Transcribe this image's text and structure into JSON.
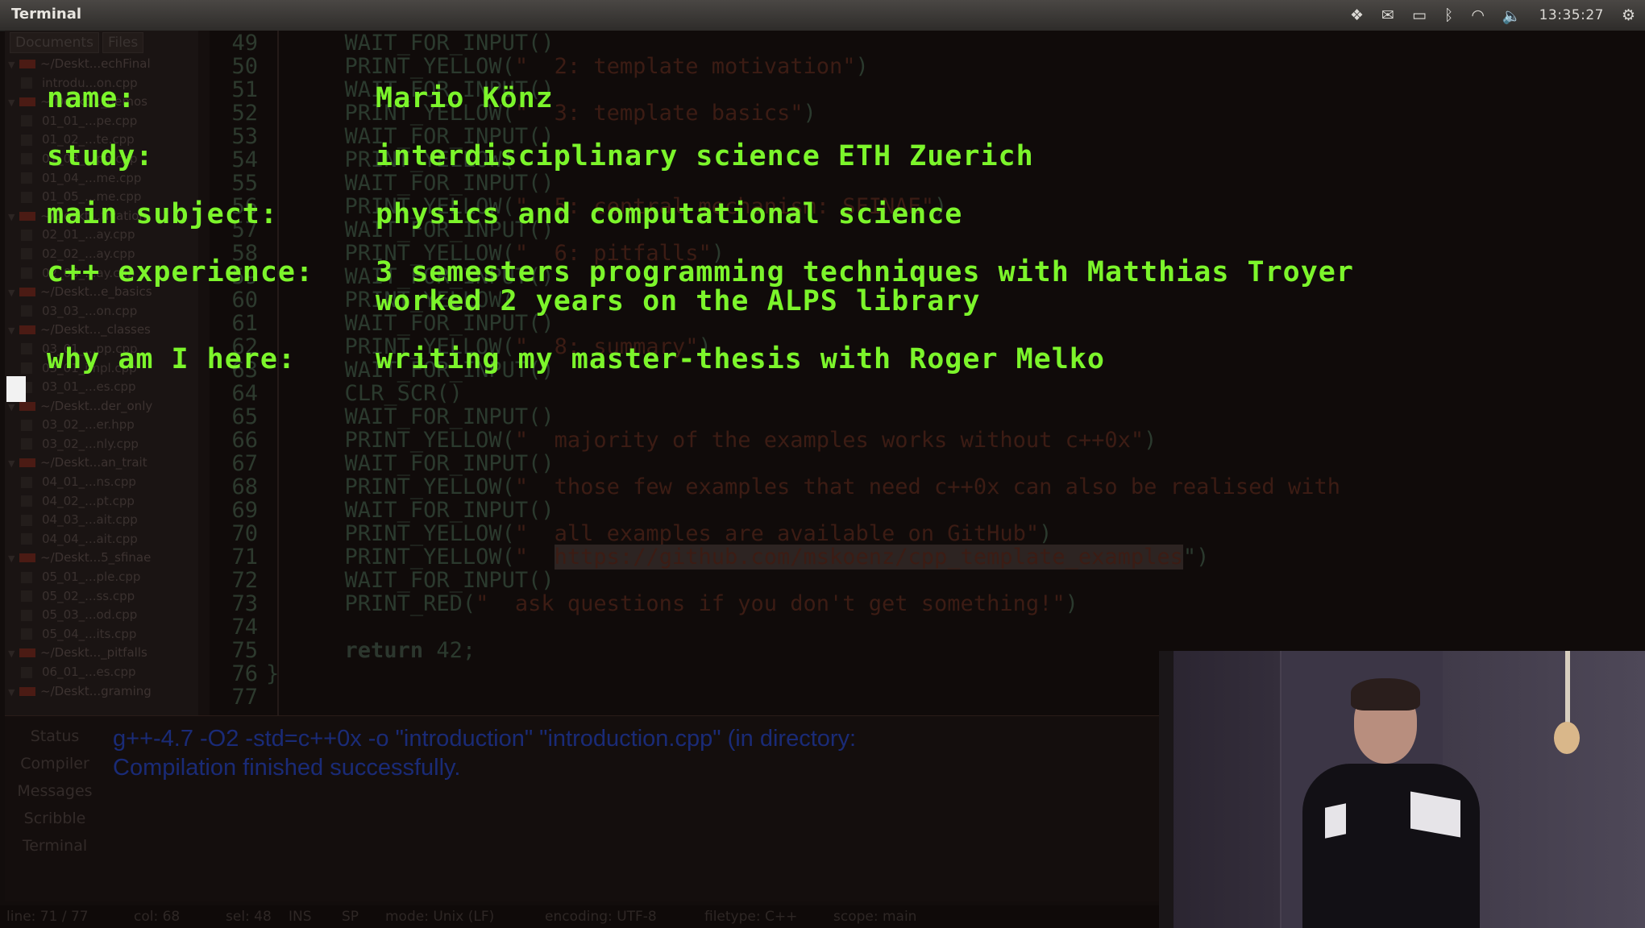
{
  "window": {
    "title": "Terminal"
  },
  "tray": {
    "clock": "13:35:27"
  },
  "sidebar": {
    "tabs": [
      "Documents",
      "Files"
    ],
    "tree": [
      {
        "type": "folder",
        "label": "~/Deskt...echFinal"
      },
      {
        "type": "file",
        "label": "introdu...on.cpp"
      },
      {
        "type": "folder",
        "label": "~/Deskt..._demos"
      },
      {
        "type": "file",
        "label": "01_01_...pe.cpp"
      },
      {
        "type": "file",
        "label": "01_02_...te.cpp"
      },
      {
        "type": "file",
        "label": "01_03_...pp.cpp"
      },
      {
        "type": "file",
        "label": "01_04_...me.cpp"
      },
      {
        "type": "file",
        "label": "01_05_...me.cpp"
      },
      {
        "type": "folder",
        "label": "~/Deskt...tivation"
      },
      {
        "type": "file",
        "label": "02_01_...ay.cpp"
      },
      {
        "type": "file",
        "label": "02_02_...ay.cpp"
      },
      {
        "type": "file",
        "label": "02_03_...ay.cpp"
      },
      {
        "type": "folder",
        "label": "~/Deskt...e_basics"
      },
      {
        "type": "file",
        "label": "03_03_...on.cpp"
      },
      {
        "type": "folder",
        "label": "~/Deskt..._classes"
      },
      {
        "type": "file",
        "label": "03_01_...pp.cpp"
      },
      {
        "type": "file",
        "label": "03_01_impl.cpp"
      },
      {
        "type": "file",
        "label": "03_01_...es.cpp"
      },
      {
        "type": "folder",
        "label": "~/Deskt...der_only"
      },
      {
        "type": "file",
        "label": "03_02_...er.hpp"
      },
      {
        "type": "file",
        "label": "03_02_...nly.cpp"
      },
      {
        "type": "folder",
        "label": "~/Deskt...an_trait"
      },
      {
        "type": "file",
        "label": "04_01_...ns.cpp"
      },
      {
        "type": "file",
        "label": "04_02_...pt.cpp"
      },
      {
        "type": "file",
        "label": "04_03_...ait.cpp"
      },
      {
        "type": "file",
        "label": "04_04_...ait.cpp"
      },
      {
        "type": "folder",
        "label": "~/Deskt...5_sfinae"
      },
      {
        "type": "file",
        "label": "05_01_...ple.cpp"
      },
      {
        "type": "file",
        "label": "05_02_...ss.cpp"
      },
      {
        "type": "file",
        "label": "05_03_...od.cpp"
      },
      {
        "type": "file",
        "label": "05_04_...its.cpp"
      },
      {
        "type": "folder",
        "label": "~/Deskt..._pitfalls"
      },
      {
        "type": "file",
        "label": "06_01_...es.cpp"
      },
      {
        "type": "folder",
        "label": "~/Deskt...graming"
      }
    ]
  },
  "editor": {
    "lines": [
      {
        "n": "49",
        "fn": "WAIT_FOR_INPUT()",
        "str": "",
        "close": ""
      },
      {
        "n": "50",
        "fn": "PRINT_YELLOW(",
        "str": "\"  2: template motivation\"",
        "close": ")"
      },
      {
        "n": "51",
        "fn": "WAIT_FOR_INPUT()",
        "str": "",
        "close": ""
      },
      {
        "n": "52",
        "fn": "PRINT_YELLOW(",
        "str": "\"  3: template basics\"",
        "close": ")"
      },
      {
        "n": "53",
        "fn": "WAIT_FOR_INPUT()",
        "str": "",
        "close": ""
      },
      {
        "n": "54",
        "fn": "PRINT_YELLOW(",
        "str": "",
        "close": ""
      },
      {
        "n": "55",
        "fn": "WAIT_FOR_INPUT()",
        "str": "",
        "close": ""
      },
      {
        "n": "56",
        "fn": "PRINT_YELLOW(",
        "str": "\"  5: central mechanism: SFINAE\"",
        "close": ")"
      },
      {
        "n": "57",
        "fn": "WAIT_FOR_INPUT()",
        "str": "",
        "close": ""
      },
      {
        "n": "58",
        "fn": "PRINT_YELLOW(",
        "str": "\"  6: pitfalls\"",
        "close": ")"
      },
      {
        "n": "59",
        "fn": "WAIT_FOR_INPUT()",
        "str": "",
        "close": ""
      },
      {
        "n": "60",
        "fn": "PRINT_YELLOW(",
        "str": "",
        "close": ""
      },
      {
        "n": "61",
        "fn": "WAIT_FOR_INPUT()",
        "str": "",
        "close": ""
      },
      {
        "n": "62",
        "fn": "PRINT_YELLOW(",
        "str": "\"  8: summary\"",
        "close": ")"
      },
      {
        "n": "63",
        "fn": "WAIT_FOR_INPUT()",
        "str": "",
        "close": ""
      },
      {
        "n": "64",
        "fn": "CLR_SCR()",
        "str": "",
        "close": ""
      },
      {
        "n": "65",
        "fn": "WAIT_FOR_INPUT()",
        "str": "",
        "close": ""
      },
      {
        "n": "66",
        "fn": "PRINT_YELLOW(",
        "str": "\"  majority of the examples works without c++0x\"",
        "close": ")"
      },
      {
        "n": "67",
        "fn": "WAIT_FOR_INPUT()",
        "str": "",
        "close": ""
      },
      {
        "n": "68",
        "fn": "PRINT_YELLOW(",
        "str": "\"  those few examples that need c++0x can also be realised with ",
        "close": ""
      },
      {
        "n": "69",
        "fn": "WAIT_FOR_INPUT()",
        "str": "",
        "close": ""
      },
      {
        "n": "70",
        "fn": "PRINT_YELLOW(",
        "str": "\"  all examples are available on GitHub\"",
        "close": ")"
      },
      {
        "n": "71",
        "fn": "PRINT_YELLOW(",
        "str": "\"  ",
        "url": "https://github.com/mskoenz/cpp_template_examples",
        "close": "\")"
      },
      {
        "n": "72",
        "fn": "WAIT_FOR_INPUT()",
        "str": "",
        "close": ""
      },
      {
        "n": "73",
        "fn": "PRINT_RED(",
        "str": "\"  ask questions if you don't get something!\"",
        "close": ")"
      },
      {
        "n": "74",
        "fn": "",
        "str": "",
        "close": ""
      },
      {
        "n": "75",
        "fn": "",
        "kw": "return",
        "num": " 42;",
        "str": "",
        "close": ""
      },
      {
        "n": "76",
        "fn": "}",
        "str": "",
        "close": ""
      },
      {
        "n": "77",
        "fn": "",
        "str": "",
        "close": ""
      }
    ]
  },
  "overlay": {
    "rows": [
      {
        "label": "name:",
        "value": "Mario Könz"
      },
      {
        "label": "study:",
        "value": "interdisciplinary science ETH Zuerich"
      },
      {
        "label": "main subject:",
        "value": "physics and computational science"
      },
      {
        "label": "c++ experience:",
        "value": "3 semesters programming techniques with Matthias Troyer"
      },
      {
        "label": "",
        "value": "worked 2 years on the ALPS library"
      },
      {
        "label": "why am I here:",
        "value": "writing my master-thesis with Roger Melko"
      }
    ]
  },
  "messages": {
    "tabs": [
      "Status",
      "Compiler",
      "Messages",
      "Scribble",
      "Terminal"
    ],
    "lines": [
      "g++-4.7 -O2 -std=c++0x -o \"introduction\" \"introduction.cpp\" (in directory:",
      "Compilation finished successfully."
    ]
  },
  "statusbar": {
    "line": "line: 71 / 77",
    "col": "col: 68",
    "sel": "sel: 48",
    "mode_ins": "INS",
    "sp": "SP",
    "mode": "mode: Unix (LF)",
    "encoding": "encoding: UTF-8",
    "filetype": "filetype: C++",
    "scope": "scope: main"
  },
  "colors": {
    "overlay_text": "#7cf52b",
    "compiler_text": "#1a2b77",
    "background": "#120d0c"
  }
}
